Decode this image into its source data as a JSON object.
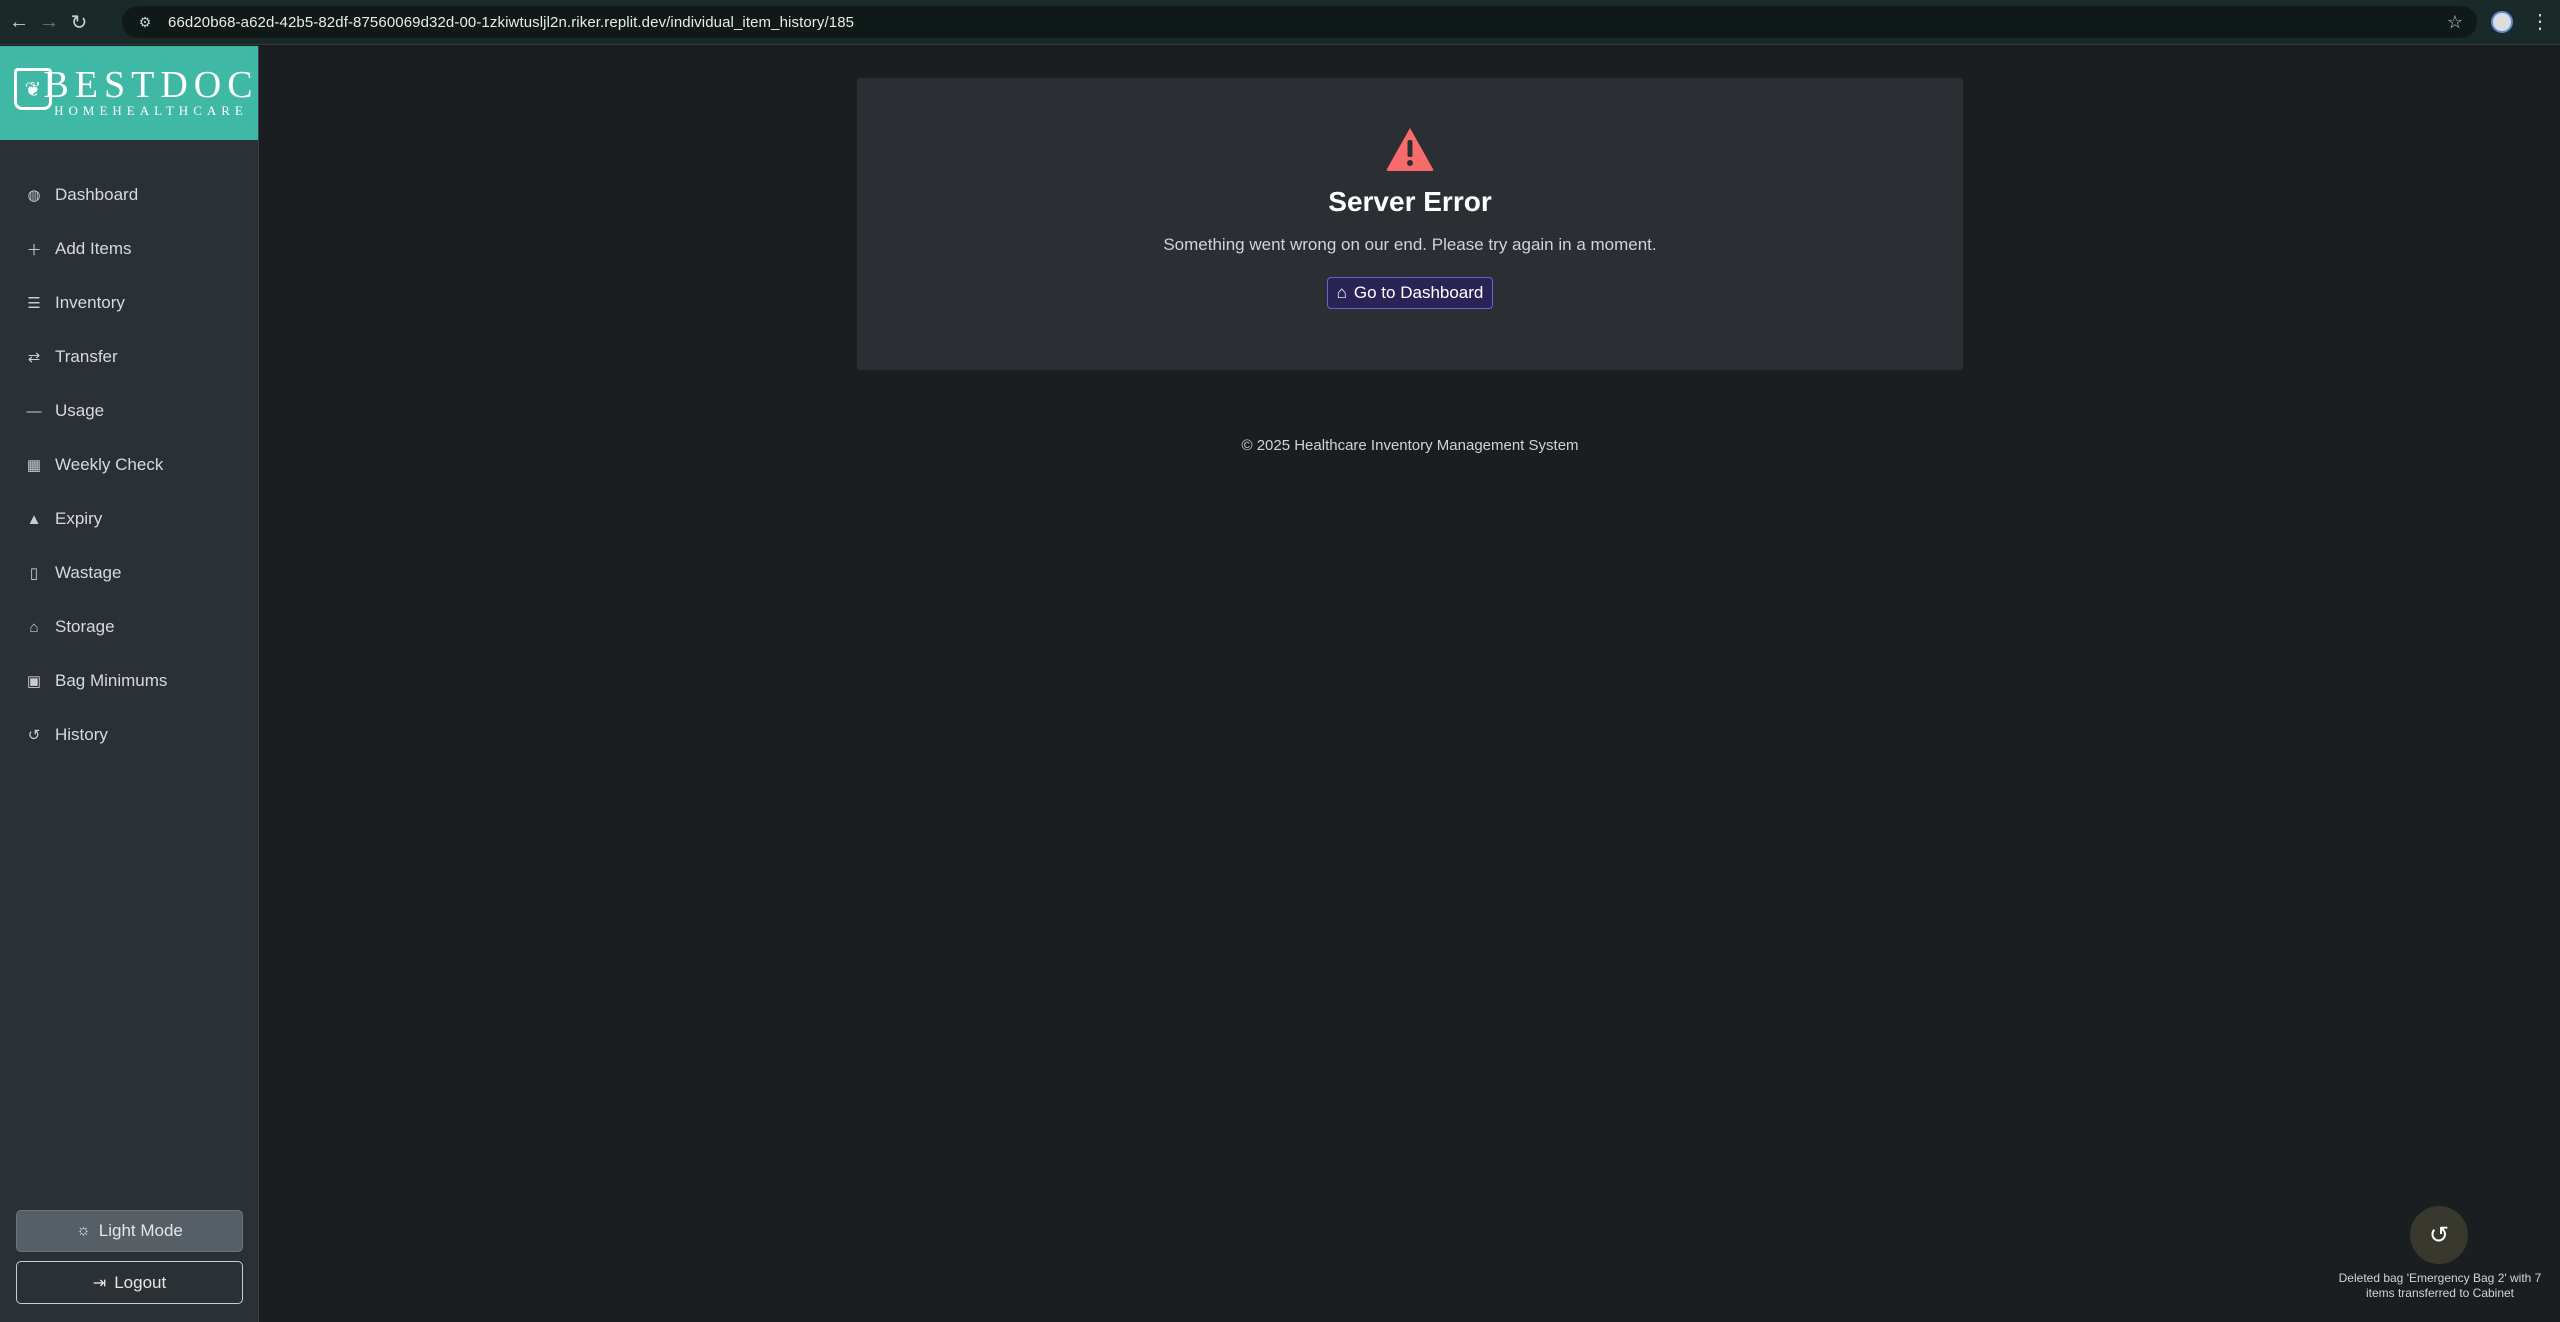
{
  "browser": {
    "url": "66d20b68-a62d-42b5-82df-87560069d32d-00-1zkiwtusljl2n.riker.replit.dev/individual_item_history/185"
  },
  "sidebar": {
    "logo": {
      "brand": "BESTDOC",
      "tagline": "HOMEHEALTHCARE"
    },
    "items": [
      {
        "label": "Dashboard",
        "icon": "palette-icon"
      },
      {
        "label": "Add Items",
        "icon": "plus-icon"
      },
      {
        "label": "Inventory",
        "icon": "list-icon"
      },
      {
        "label": "Transfer",
        "icon": "arrows-icon"
      },
      {
        "label": "Usage",
        "icon": "minus-icon"
      },
      {
        "label": "Weekly Check",
        "icon": "calendar-check-icon"
      },
      {
        "label": "Expiry",
        "icon": "warning-icon"
      },
      {
        "label": "Wastage",
        "icon": "trash-icon"
      },
      {
        "label": "Storage",
        "icon": "warehouse-icon"
      },
      {
        "label": "Bag Minimums",
        "icon": "medkit-icon"
      },
      {
        "label": "History",
        "icon": "history-icon"
      }
    ],
    "theme_toggle": "Light Mode",
    "logout": "Logout"
  },
  "error": {
    "title": "Server Error",
    "message": "Something went wrong on our end. Please try again in a moment.",
    "button": "Go to Dashboard",
    "icon_color": "#f86b6b"
  },
  "footer": {
    "text": "© 2025 Healthcare Inventory Management System"
  },
  "toast": {
    "message": "Deleted bag 'Emergency Bag 2' with 7 items transferred to Cabinet"
  },
  "colors": {
    "accent": "#3fb8a6",
    "button_border": "#6f5ed6"
  }
}
